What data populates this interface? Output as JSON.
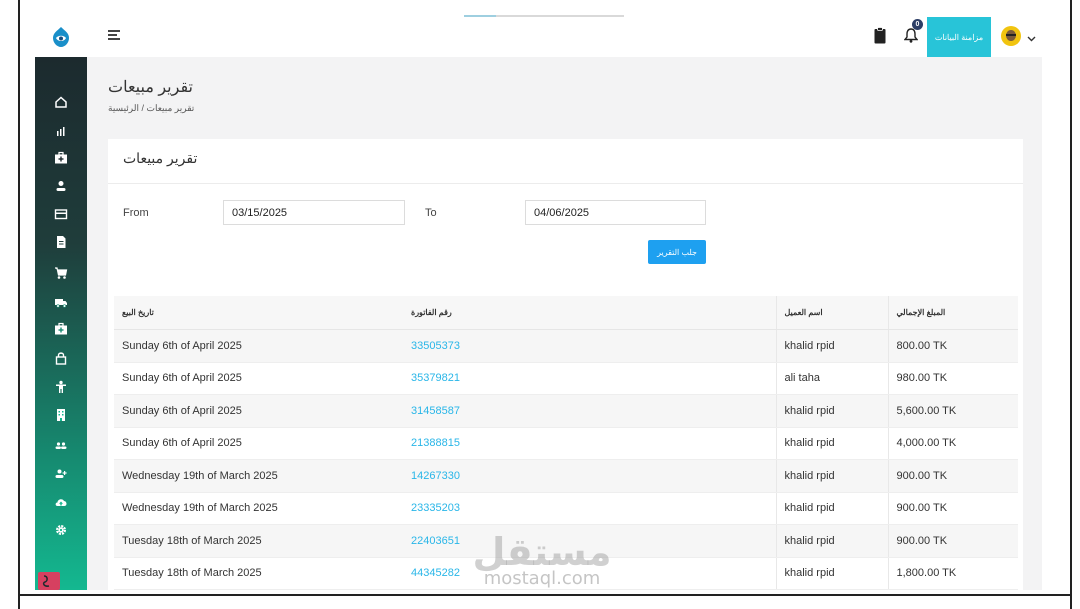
{
  "header": {
    "sync_label": "مزامنة البيانات",
    "notification_count": "0",
    "loading_progress": 0.2
  },
  "page": {
    "title": "تقرير مبيعات",
    "breadcrumb": "تقرير مبيعات  /  الرئيسية"
  },
  "card": {
    "title": "تقرير مبيعات",
    "from_label": "From",
    "from_value": "03/15/2025",
    "to_label": "To",
    "to_value": "04/06/2025",
    "fetch_label": "جلب التقرير"
  },
  "table": {
    "headers": [
      "تاريخ البيع",
      "رقم الفاتورة",
      "اسم العميل",
      "المبلغ الإجمالي"
    ],
    "rows": [
      [
        "Sunday 6th of April 2025",
        "33505373",
        "khalid rpid",
        "800.00 TK"
      ],
      [
        "Sunday 6th of April 2025",
        "35379821",
        "ali taha",
        "980.00 TK"
      ],
      [
        "Sunday 6th of April 2025",
        "31458587",
        "khalid rpid",
        "5,600.00 TK"
      ],
      [
        "Sunday 6th of April 2025",
        "21388815",
        "khalid rpid",
        "4,000.00 TK"
      ],
      [
        "Wednesday 19th of March 2025",
        "14267330",
        "khalid rpid",
        "900.00 TK"
      ],
      [
        "Wednesday 19th of March 2025",
        "23335203",
        "khalid rpid",
        "900.00 TK"
      ],
      [
        "Tuesday 18th of March 2025",
        "22403651",
        "khalid rpid",
        "900.00 TK"
      ],
      [
        "Tuesday 18th of March 2025",
        "44345282",
        "khalid rpid",
        "1,800.00 TK"
      ]
    ]
  },
  "sidebar_icons": [
    "home-icon",
    "bar-chart-icon",
    "medical-case-icon",
    "user-icon",
    "card-icon",
    "document-icon",
    "cart-icon",
    "truck-icon",
    "medkit-icon",
    "lock-icon",
    "person-icon",
    "building-icon",
    "users-icon",
    "user-add-icon",
    "cloud-upload-icon",
    "gear-icon"
  ],
  "watermark": {
    "logo": "مستقل",
    "text": "mostaql.com"
  },
  "colors": {
    "accent": "#28c4d8",
    "button": "#1ea0f0",
    "link": "#29b6e8"
  }
}
